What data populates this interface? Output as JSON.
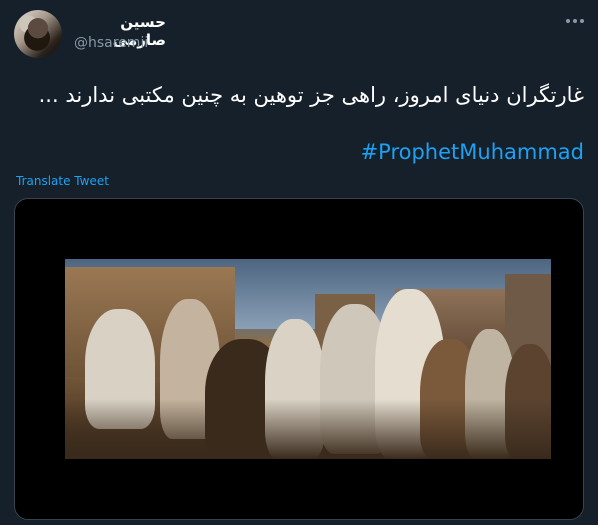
{
  "tweet": {
    "author_name": "حسین صارمی",
    "handle": "@hsaremii",
    "text": "غارتگران دنیای امروز، راهی جز توهین به چنین مکتبی ندارند ...",
    "hashtag": "#ProphetMuhammad",
    "translate_label": "Translate Tweet"
  },
  "icons": {
    "more": "more-options-icon"
  },
  "colors": {
    "background": "#15202b",
    "link": "#1da1f2",
    "muted": "#8899a6"
  }
}
